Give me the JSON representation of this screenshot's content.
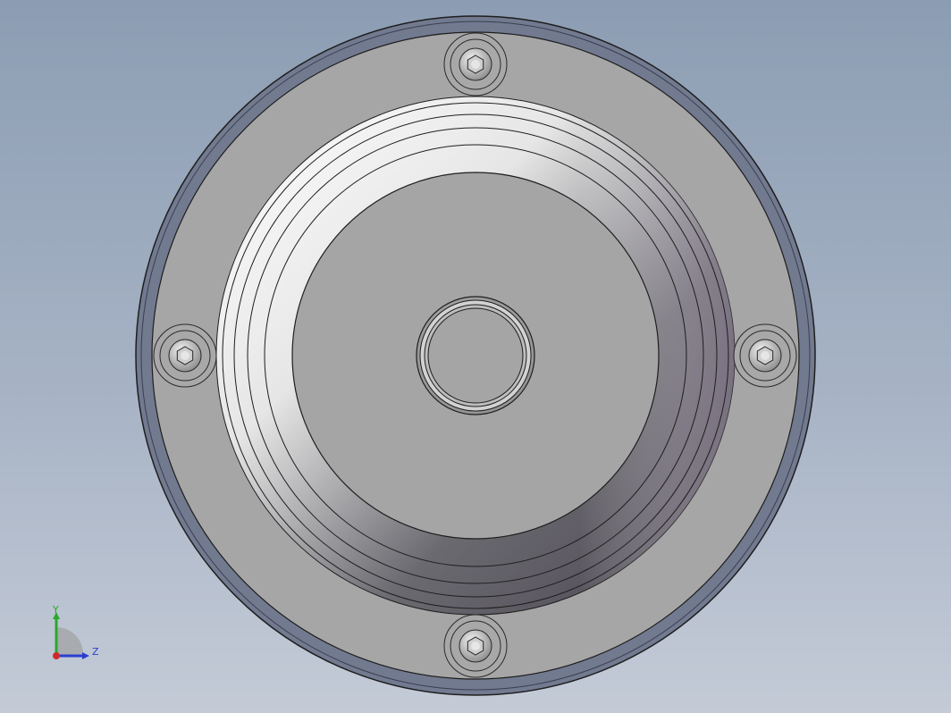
{
  "viewport": {
    "background_top": "#8c9db3",
    "background_bottom": "#c4cbd7"
  },
  "model": {
    "description_icon": "flange-cover-part",
    "colors": {
      "outer_rim": "#727a90",
      "face": "#a6a6a6",
      "edge": "#1e1e1e",
      "boss": "#d8d8d8"
    },
    "bolt_count": 4
  },
  "triad": {
    "x_label": "",
    "y_label": "Y",
    "z_label": "Z",
    "y_color": "#2aa82a",
    "z_color": "#2a3fd0",
    "x_color": "#d02a2a"
  }
}
